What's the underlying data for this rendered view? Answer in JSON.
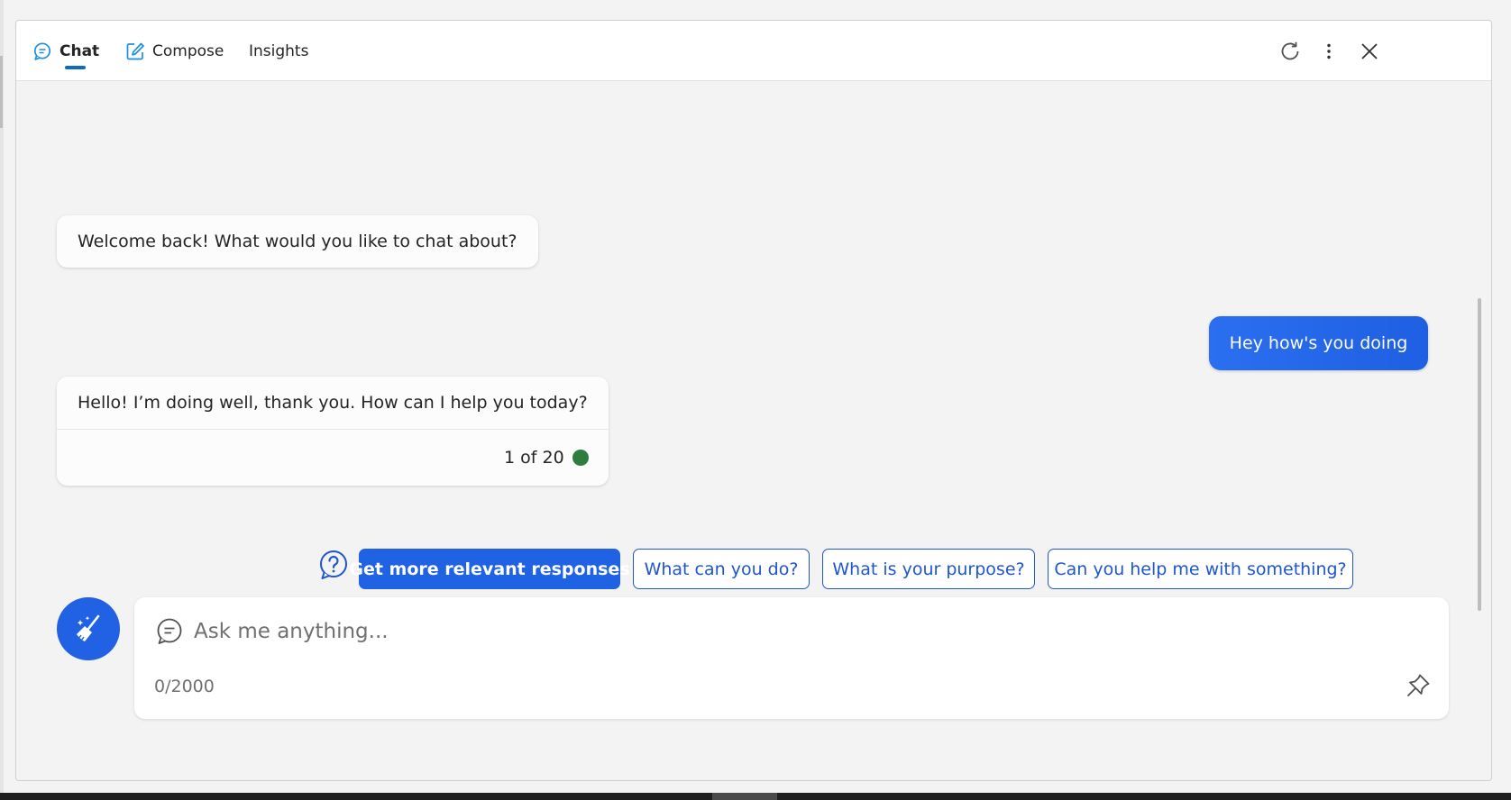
{
  "tabs": [
    {
      "label": "Chat",
      "icon": "chat-bubble-icon",
      "active": true
    },
    {
      "label": "Compose",
      "icon": "compose-icon",
      "active": false
    },
    {
      "label": "Insights",
      "icon": "",
      "active": false
    }
  ],
  "messages": [
    {
      "role": "bot",
      "text": "Welcome back! What would you like to chat about?"
    },
    {
      "role": "user",
      "text": "Hey how's you doing"
    },
    {
      "role": "bot",
      "text": "Hello! I’m doing well, thank you. How can I help you today?",
      "footer": "1 of 20"
    }
  ],
  "suggestions": [
    {
      "label": "Get more relevant responses",
      "style": "primary"
    },
    {
      "label": "What can you do?",
      "style": "outline"
    },
    {
      "label": "What is your purpose?",
      "style": "outline"
    },
    {
      "label": "Can you help me with something?",
      "style": "outline"
    }
  ],
  "composer": {
    "placeholder": "Ask me anything...",
    "value": "",
    "counter": "0/2000"
  },
  "colors": {
    "accent": "#1f62e4",
    "tab_underline": "#0f6cbd",
    "status_dot": "#2e7d3e"
  }
}
